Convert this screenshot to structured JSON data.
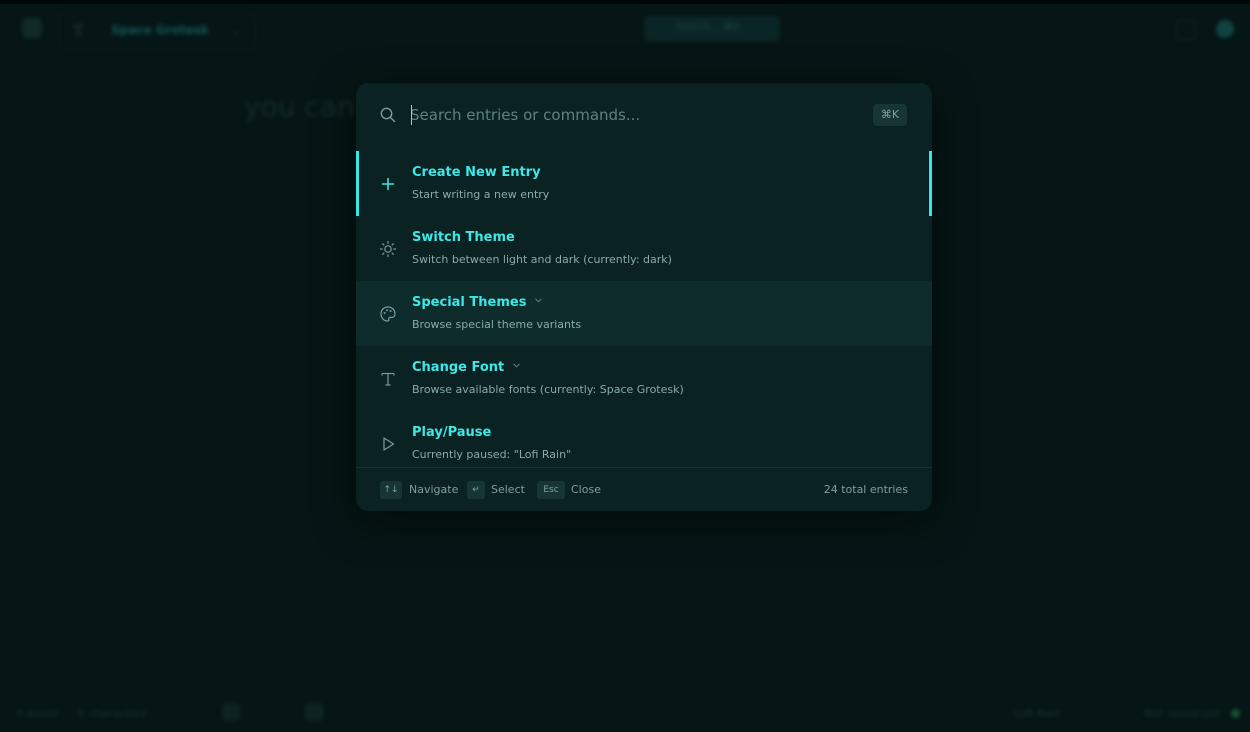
{
  "background_app": {
    "font_name": "Space Grotesk",
    "search_hint": "Search... ⌘K",
    "editor_placeholder": "you can",
    "footer": {
      "words": "0 words",
      "characters": "0 characters",
      "track": "Lofi Rain",
      "saved_status": "Not saved yet"
    }
  },
  "palette": {
    "search": {
      "placeholder": "Search entries or commands...",
      "value": "",
      "shortcut": "⌘K"
    },
    "items": [
      {
        "title": "Create New Entry",
        "subtitle": "Start writing a new entry",
        "icon": "plus-icon",
        "active": true,
        "has_submenu": false
      },
      {
        "title": "Switch Theme",
        "subtitle": "Switch between light and dark (currently: dark)",
        "icon": "sun-icon",
        "active": false,
        "has_submenu": false
      },
      {
        "title": "Special Themes",
        "subtitle": "Browse special theme variants",
        "icon": "palette-icon",
        "active": false,
        "hovered": true,
        "has_submenu": true
      },
      {
        "title": "Change Font",
        "subtitle": "Browse available fonts (currently: Space Grotesk)",
        "icon": "font-icon",
        "active": false,
        "has_submenu": true
      },
      {
        "title": "Play/Pause",
        "subtitle": "Currently paused: \"Lofi Rain\"",
        "icon": "play-icon",
        "active": false,
        "has_submenu": false
      }
    ],
    "footer": {
      "navigate_key": "↑↓",
      "navigate_label": "Navigate",
      "select_key": "↵",
      "select_label": "Select",
      "close_key": "Esc",
      "close_label": "Close",
      "total": "24 total entries"
    }
  },
  "colors": {
    "accent": "#3ee8e8",
    "background": "#061515",
    "panel": "#0a2222"
  }
}
